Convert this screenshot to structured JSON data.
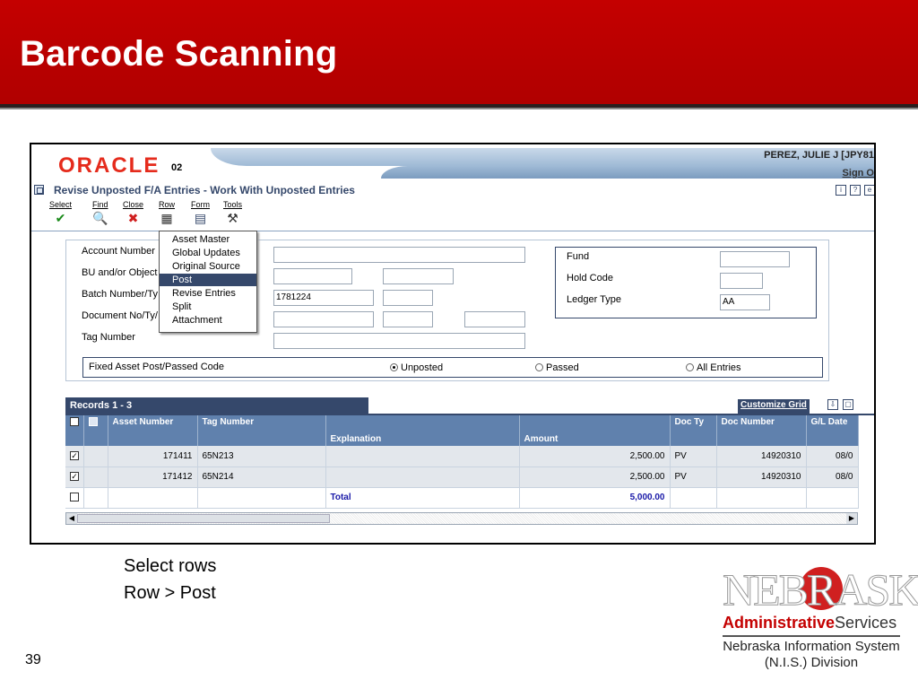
{
  "slide": {
    "title": "Barcode Scanning",
    "page_number": "39",
    "instructions": [
      "Select rows",
      "Row > Post"
    ]
  },
  "app": {
    "logo": "ORACLE",
    "version": "02",
    "user": "PEREZ, JULIE J  [JPY81",
    "sign_out": "Sign O",
    "form_title": "Revise Unposted F/A Entries - Work With Unposted Entries",
    "title_icons": [
      "i",
      "?",
      "e"
    ]
  },
  "toolbar": [
    {
      "label": "Select",
      "icon": "check-icon",
      "glyph": "✔",
      "color": "#1a8a1a"
    },
    {
      "label": "Find",
      "icon": "find-icon",
      "glyph": "🔍",
      "color": "#333333"
    },
    {
      "label": "Close",
      "icon": "close-icon",
      "glyph": "✖",
      "color": "#d02020"
    },
    {
      "label": "Row",
      "icon": "row-icon",
      "glyph": "▦",
      "color": "#333333"
    },
    {
      "label": "Form",
      "icon": "form-icon",
      "glyph": "▤",
      "color": "#35486b"
    },
    {
      "label": "Tools",
      "icon": "tools-icon",
      "glyph": "⚒",
      "color": "#333333"
    }
  ],
  "row_menu": [
    "Asset Master",
    "Global Updates",
    "Original Source",
    "Post",
    "Revise Entries",
    "Split",
    "Attachment"
  ],
  "row_menu_selected": "Post",
  "query": {
    "account_number_label": "Account Number",
    "bu_object_label": "BU and/or Object",
    "batch_label": "Batch Number/Ty",
    "batch_value": "1781224",
    "document_label": "Document No/Ty/",
    "tag_label": "Tag Number",
    "fund_label": "Fund",
    "hold_code_label": "Hold Code",
    "ledger_type_label": "Ledger Type",
    "ledger_type_value": "AA",
    "post_code_label": "Fixed Asset Post/Passed Code",
    "radios": [
      {
        "label": "Unposted",
        "selected": true
      },
      {
        "label": "Passed",
        "selected": false
      },
      {
        "label": "All Entries",
        "selected": false
      }
    ]
  },
  "grid": {
    "records": "Records 1 - 3",
    "customize": "Customize Grid",
    "columns": [
      "Asset Number",
      "Tag Number",
      "Explanation",
      "Amount",
      "Doc Ty",
      "Doc Number",
      "G/L Date"
    ],
    "rows": [
      {
        "checked": true,
        "asset": "171411",
        "tag": "65N213",
        "explanation": "",
        "amount": "2,500.00",
        "doc_ty": "PV",
        "doc_number": "14920310",
        "gl_date": "08/0"
      },
      {
        "checked": true,
        "asset": "171412",
        "tag": "65N214",
        "explanation": "",
        "amount": "2,500.00",
        "doc_ty": "PV",
        "doc_number": "14920310",
        "gl_date": "08/0"
      }
    ],
    "total_label": "Total",
    "total_amount": "5,000.00"
  },
  "logo": {
    "nebraska": "NEBRASKA",
    "admin": "Administrative",
    "services": "Services",
    "nis_line1": "Nebraska Information System",
    "nis_line2": "(N.I.S.) Division"
  }
}
